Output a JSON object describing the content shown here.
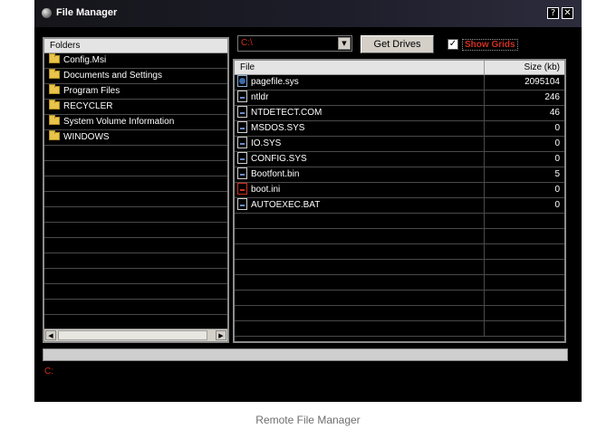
{
  "window": {
    "title": "File Manager",
    "help_glyph": "?",
    "close_glyph": "✕"
  },
  "folders": {
    "header": "Folders",
    "items": [
      "Config.Msi",
      "Documents and Settings",
      "Program Files",
      "RECYCLER",
      "System Volume Information",
      "WINDOWS"
    ]
  },
  "toolbar": {
    "drive_value": "C:\\",
    "get_drives_label": "Get Drives",
    "show_grids_label": "Show Grids",
    "show_grids_checked": true,
    "check_glyph": "✓"
  },
  "files": {
    "col_file": "File",
    "col_size": "Size (kb)",
    "rows": [
      {
        "name": "pagefile.sys",
        "size": "2095104",
        "icon": "system-file-icon"
      },
      {
        "name": "ntldr",
        "size": "246",
        "icon": "file-icon"
      },
      {
        "name": "NTDETECT.COM",
        "size": "46",
        "icon": "file-icon"
      },
      {
        "name": "MSDOS.SYS",
        "size": "0",
        "icon": "file-icon"
      },
      {
        "name": "IO.SYS",
        "size": "0",
        "icon": "file-icon"
      },
      {
        "name": "CONFIG.SYS",
        "size": "0",
        "icon": "file-icon"
      },
      {
        "name": "Bootfont.bin",
        "size": "5",
        "icon": "file-icon"
      },
      {
        "name": "boot.ini",
        "size": "0",
        "icon": "ini-file-icon"
      },
      {
        "name": "AUTOEXEC.BAT",
        "size": "0",
        "icon": "file-icon"
      }
    ]
  },
  "status": {
    "path": "C:"
  },
  "caption": "Remote File Manager",
  "colors": {
    "accent_red": "#d03020",
    "background": "#000000",
    "header_gray": "#e4e4e4"
  }
}
